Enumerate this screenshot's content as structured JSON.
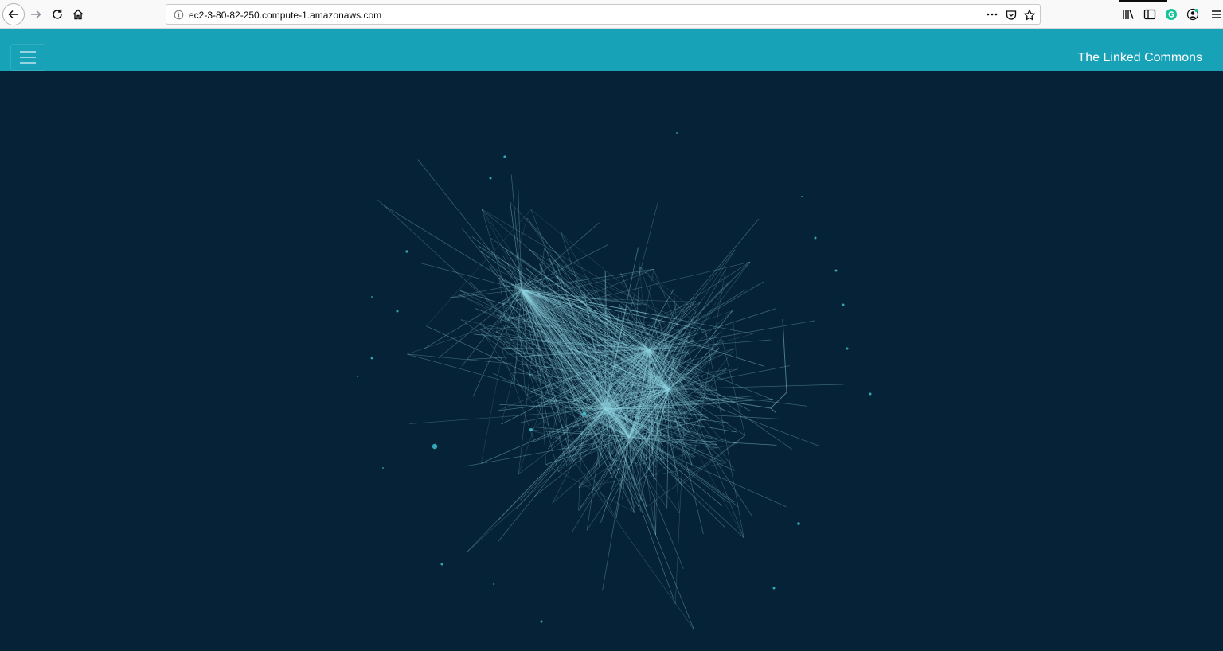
{
  "browser": {
    "url": "ec2-3-80-82-250.compute-1.amazonaws.com"
  },
  "app": {
    "brand": "The Linked Commons"
  },
  "icons": {
    "back": "arrow-left-icon",
    "forward": "arrow-right-icon",
    "reload": "reload-icon",
    "home": "home-icon",
    "info": "info-icon",
    "page_actions": "more-horizontal-icon",
    "pocket": "pocket-icon",
    "bookmark": "star-icon",
    "library": "library-icon",
    "sidebar": "sidebar-icon",
    "grammarly": "grammarly-icon",
    "account": "account-icon",
    "menu": "hamburger-menu-icon",
    "app_menu": "hamburger-menu-icon"
  },
  "colors": {
    "header": "#17a2b8",
    "canvas": "#062236",
    "edge": "#8fd3e0",
    "node": "#3ec9d6"
  }
}
